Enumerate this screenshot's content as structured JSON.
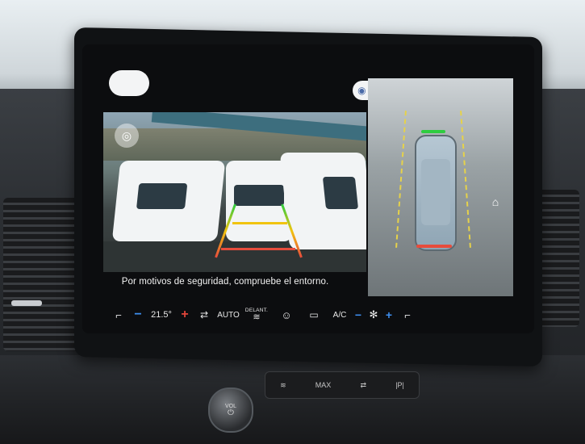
{
  "screen": {
    "warning_text": "Por motivos de seguridad, compruebe el entorno."
  },
  "climate": {
    "temperature": "21.5°",
    "auto_label": "AUTO",
    "front_defrost_label": "DELANT.",
    "ac_label": "A/C",
    "minus_symbol": "−",
    "plus_symbol": "+"
  },
  "console": {
    "volume_label": "VOL",
    "max_label": "MAX",
    "power_symbol": "⏻"
  },
  "icons": {
    "camera": "camera-icon",
    "seat_heat": "seat-heat-icon",
    "fan": "fan-icon",
    "door": "door-icon"
  }
}
